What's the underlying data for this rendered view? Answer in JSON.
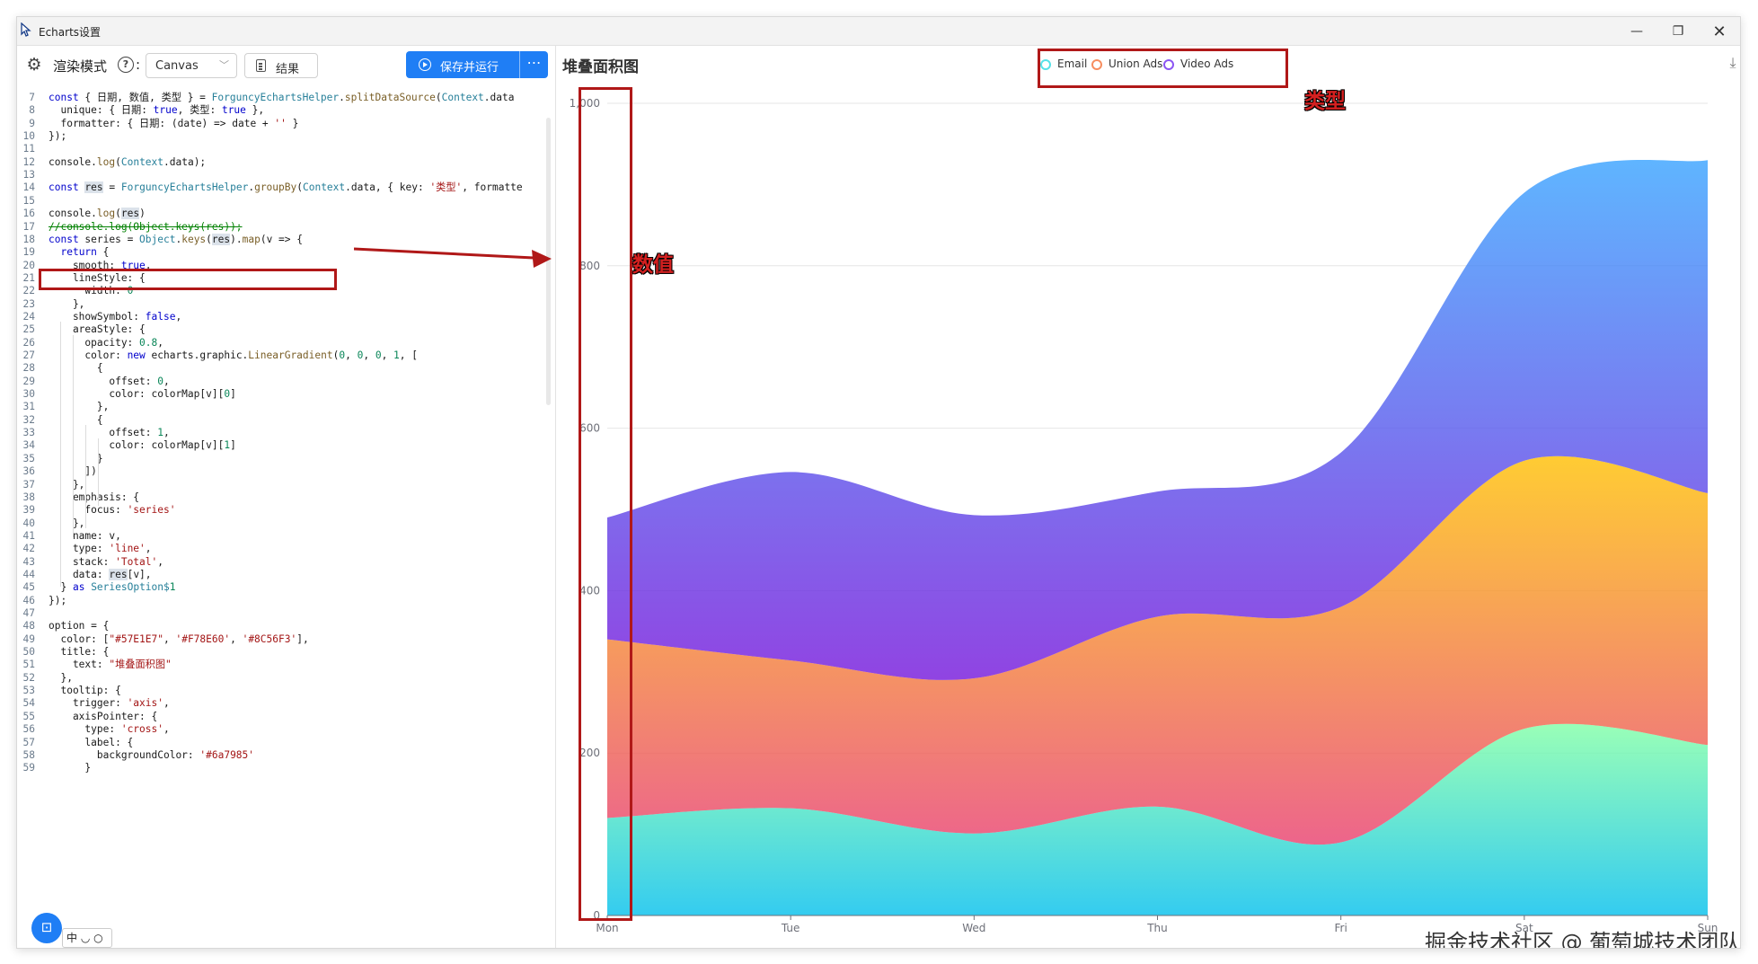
{
  "window": {
    "title": "Echarts设置",
    "minimize_icon": "minimize-icon",
    "maximize_icon": "maximize-icon",
    "close_icon": "close-icon"
  },
  "toolbar": {
    "render_mode_label": "渲染模式",
    "help_symbol": "?",
    "help_colon": ":",
    "render_select_value": "Canvas",
    "result_label": "结果",
    "run_label": "保存并运行",
    "more_label": "⋯"
  },
  "editor": {
    "lines": [
      {
        "n": "7",
        "text": "const { 日期, 数值, 类型 } = ForguncyEchartsHelper.splitDataSource(Context.data"
      },
      {
        "n": "8",
        "text": "  unique: { 日期: true, 类型: true },"
      },
      {
        "n": "9",
        "text": "  formatter: { 日期: (date) => date + '' }"
      },
      {
        "n": "10",
        "text": "});"
      },
      {
        "n": "11",
        "text": ""
      },
      {
        "n": "12",
        "text": "console.log(Context.data);"
      },
      {
        "n": "13",
        "text": ""
      },
      {
        "n": "14",
        "text": "const res = ForguncyEchartsHelper.groupBy(Context.data, { key: '类型', formatte"
      },
      {
        "n": "15",
        "text": ""
      },
      {
        "n": "16",
        "text": "console.log(res)"
      },
      {
        "n": "17",
        "text": "//console.log(Object.keys(res));"
      },
      {
        "n": "18",
        "text": "const series = Object.keys(res).map(v => {"
      },
      {
        "n": "19",
        "text": "  return {"
      },
      {
        "n": "20",
        "text": "    smooth: true,"
      },
      {
        "n": "21",
        "text": "    lineStyle: {"
      },
      {
        "n": "22",
        "text": "      width: 0"
      },
      {
        "n": "23",
        "text": "    },"
      },
      {
        "n": "24",
        "text": "    showSymbol: false,"
      },
      {
        "n": "25",
        "text": "    areaStyle: {"
      },
      {
        "n": "26",
        "text": "      opacity: 0.8,"
      },
      {
        "n": "27",
        "text": "      color: new echarts.graphic.LinearGradient(0, 0, 0, 1, ["
      },
      {
        "n": "28",
        "text": "        {"
      },
      {
        "n": "29",
        "text": "          offset: 0,"
      },
      {
        "n": "30",
        "text": "          color: colorMap[v][0]"
      },
      {
        "n": "31",
        "text": "        },"
      },
      {
        "n": "32",
        "text": "        {"
      },
      {
        "n": "33",
        "text": "          offset: 1,"
      },
      {
        "n": "34",
        "text": "          color: colorMap[v][1]"
      },
      {
        "n": "35",
        "text": "        }"
      },
      {
        "n": "36",
        "text": "      ])"
      },
      {
        "n": "37",
        "text": "    },"
      },
      {
        "n": "38",
        "text": "    emphasis: {"
      },
      {
        "n": "39",
        "text": "      focus: 'series'"
      },
      {
        "n": "40",
        "text": "    },"
      },
      {
        "n": "41",
        "text": "    name: v,"
      },
      {
        "n": "42",
        "text": "    type: 'line',"
      },
      {
        "n": "43",
        "text": "    stack: 'Total',"
      },
      {
        "n": "44",
        "text": "    data: res[v],"
      },
      {
        "n": "45",
        "text": "  } as SeriesOption$1"
      },
      {
        "n": "46",
        "text": "});"
      },
      {
        "n": "47",
        "text": ""
      },
      {
        "n": "48",
        "text": "option = {"
      },
      {
        "n": "49",
        "text": "  color: [\"#57E1E7\", '#F78E60', '#8C56F3'],"
      },
      {
        "n": "50",
        "text": "  title: {"
      },
      {
        "n": "51",
        "text": "    text: \"堆叠面积图\""
      },
      {
        "n": "52",
        "text": "  },"
      },
      {
        "n": "53",
        "text": "  tooltip: {"
      },
      {
        "n": "54",
        "text": "    trigger: 'axis',"
      },
      {
        "n": "55",
        "text": "    axisPointer: {"
      },
      {
        "n": "56",
        "text": "      type: 'cross',"
      },
      {
        "n": "57",
        "text": "      label: {"
      },
      {
        "n": "58",
        "text": "        backgroundColor: '#6a7985'"
      },
      {
        "n": "59",
        "text": "      }"
      }
    ],
    "terminal_icon": "terminal-icon",
    "ime_text": "中 ◡ ○"
  },
  "annotations": {
    "type_label": "类型",
    "value_label": "数值",
    "accent": "#b01818"
  },
  "watermark": "掘金技术社区 @ 葡萄城技术团队",
  "chart_data": {
    "type": "area",
    "title": "堆叠面积图",
    "stacked": true,
    "smooth": true,
    "categories": [
      "Mon",
      "Tue",
      "Wed",
      "Thu",
      "Fri",
      "Sat",
      "Sun"
    ],
    "yticks": [
      "0",
      "200",
      "400",
      "600",
      "800",
      "1,000"
    ],
    "ylim": [
      0,
      1000
    ],
    "grid": true,
    "legend_position": "top-center",
    "series": [
      {
        "name": "Email",
        "values": [
          120,
          132,
          101,
          134,
          90,
          230,
          210
        ],
        "gradient": [
          "#80FFA5",
          "#01BFEC"
        ]
      },
      {
        "name": "Union Ads",
        "values": [
          220,
          182,
          191,
          234,
          290,
          330,
          310
        ],
        "gradient": [
          "#FFBF00",
          "#E83E6E"
        ]
      },
      {
        "name": "Video Ads",
        "values": [
          150,
          232,
          201,
          154,
          190,
          330,
          410
        ],
        "gradient": [
          "#37A2FF",
          "#7415DB"
        ]
      }
    ],
    "legend_colors": [
      "#57E1E7",
      "#F78E60",
      "#8C56F3"
    ]
  }
}
